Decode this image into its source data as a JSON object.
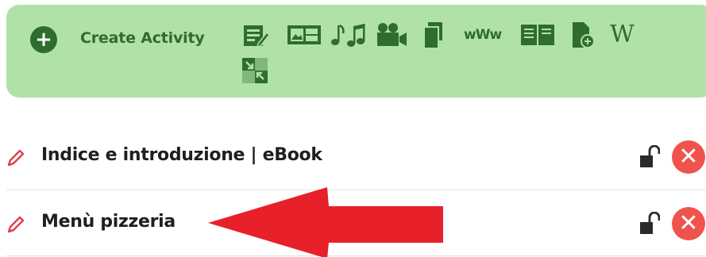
{
  "toolbar": {
    "create_label": "Create Activity",
    "create_icon": "plus-icon",
    "tool_icons": [
      "notes-icon",
      "image-gallery-icon",
      "music-icon",
      "video-camera-icon",
      "documents-icon",
      "web-link-icon",
      "ebook-icon",
      "file-add-icon",
      "wikipedia-icon",
      "embed-icon"
    ],
    "wikipedia_glyph": "W",
    "www_glyph": "wWw"
  },
  "resources": [
    {
      "title": "Indice e introduzione | eBook",
      "edit_icon": "pencil-icon",
      "lock_icon": "unlock-icon",
      "delete_icon": "close-icon",
      "delete_glyph": "✕"
    },
    {
      "title": "Menù pizzeria",
      "edit_icon": "pencil-icon",
      "lock_icon": "unlock-icon",
      "delete_icon": "close-icon",
      "delete_glyph": "✕"
    }
  ],
  "annotation": {
    "arrow_color": "#e8202a"
  },
  "colors": {
    "toolbar_bg": "#b0e2a8",
    "accent_green": "#2e6d2b",
    "delete_red": "#f0534b",
    "pencil_red": "#e0404a"
  }
}
